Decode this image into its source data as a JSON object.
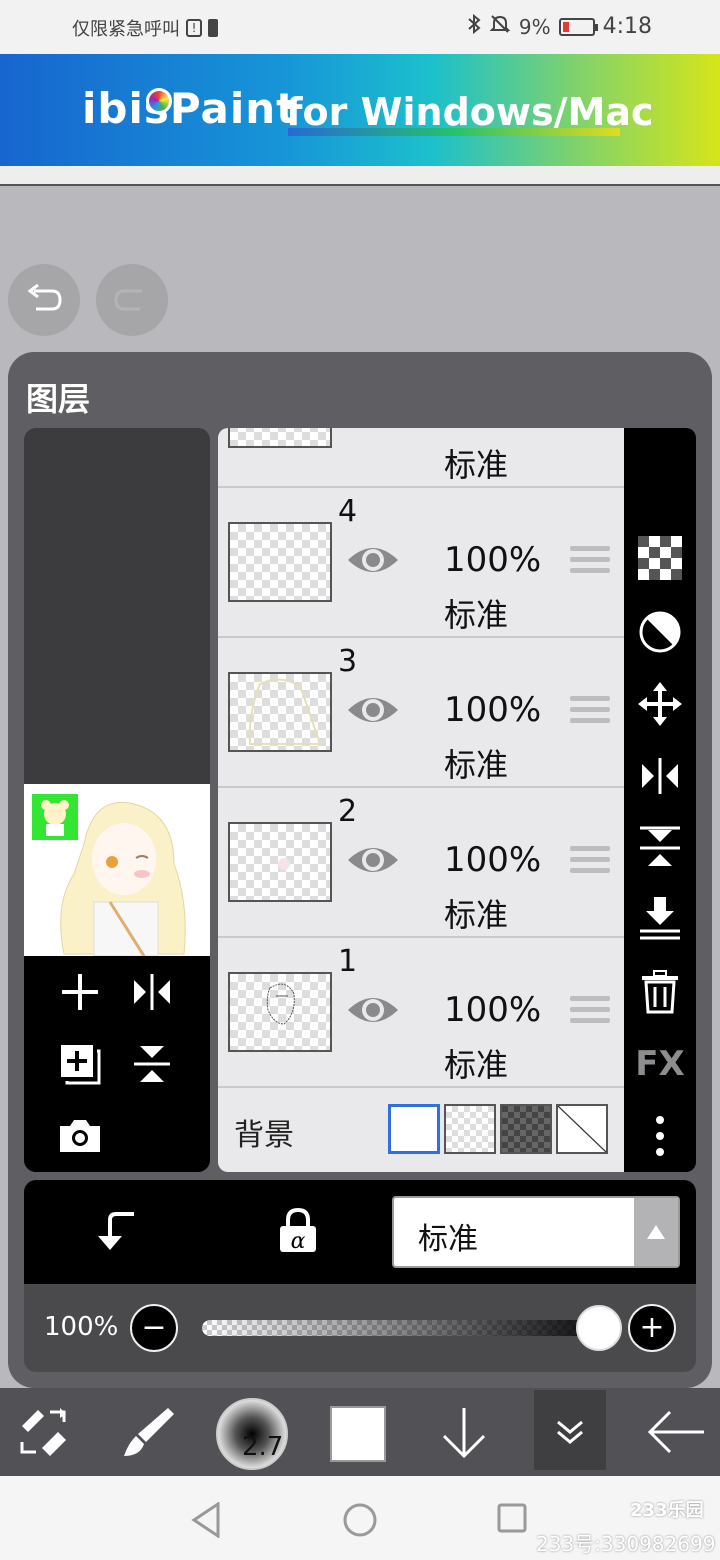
{
  "status_bar": {
    "left_text": "仅限紧急呼叫",
    "battery_percent": "9%",
    "time": "4:18"
  },
  "banner": {
    "logo": "ibisPaint",
    "tagline": "for Windows/Mac"
  },
  "panel": {
    "title": "图层"
  },
  "layers": [
    {
      "number": "4",
      "opacity": "100%",
      "mode": "标准"
    },
    {
      "number": "3",
      "opacity": "100%",
      "mode": "标准"
    },
    {
      "number": "2",
      "opacity": "100%",
      "mode": "标准"
    },
    {
      "number": "1",
      "opacity": "100%",
      "mode": "标准"
    }
  ],
  "partial_layer": {
    "mode": "标准"
  },
  "background": {
    "label": "背景"
  },
  "sidebar": {
    "fx_label": "FX"
  },
  "blend_mode": {
    "value": "标准"
  },
  "opacity": {
    "label": "100%",
    "minus": "−",
    "plus": "+",
    "level": 1.0
  },
  "toolbar": {
    "brush_size": "2.7"
  },
  "watermark": {
    "logo": "233乐园",
    "text": "233号:330982699"
  },
  "colors": {
    "panel_bg": "#5f5f63",
    "list_bg": "#e9e9ec",
    "selected_swatch_border": "#2f6fe0"
  }
}
